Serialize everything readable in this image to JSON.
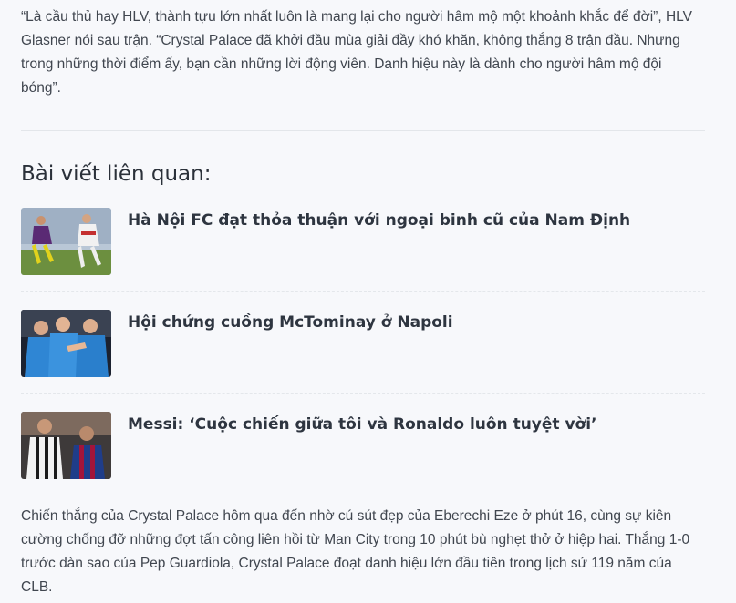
{
  "article": {
    "quote_paragraph": "“Là cầu thủ hay HLV, thành tựu lớn nhất luôn là mang lại cho người hâm mộ một khoảnh khắc để đời”, HLV Glasner nói sau trận. “Crystal Palace đã khởi đầu mùa giải đầy khó khăn, không thắng 8 trận đầu. Nhưng trong những thời điểm ấy, bạn cần những lời động viên. Danh hiệu này là dành cho người hâm mộ đội bóng”.",
    "closing_paragraph": "Chiến thắng của Crystal Palace hôm qua đến nhờ cú sút đẹp của Eberechi Eze ở phút 16, cùng sự kiên cường chống đỡ những đợt tấn công liên hồi từ Man City trong 10 phút bù nghẹt thở ở hiệp hai. Thắng 1-0 trước dàn sao của Pep Guardiola, Crystal Palace đoạt danh hiệu lớn đầu tiên trong lịch sử 119 năm của CLB."
  },
  "related": {
    "heading": "Bài viết liên quan:",
    "items": [
      {
        "title": "Hà Nội FC đạt thỏa thuận với ngoại binh cũ của Nam Định",
        "thumb": "football-players-photo"
      },
      {
        "title": "Hội chứng cuồng McTominay ở Napoli",
        "thumb": "napoli-players-photo"
      },
      {
        "title": "Messi: ‘Cuộc chiến giữa tôi và Ronaldo luôn tuyệt vời’",
        "thumb": "messi-ronaldo-photo"
      }
    ]
  },
  "colors": {
    "background": "#f7f8fb",
    "text": "#40464f",
    "heading": "#2b313a",
    "divider": "#e3e6ea"
  }
}
